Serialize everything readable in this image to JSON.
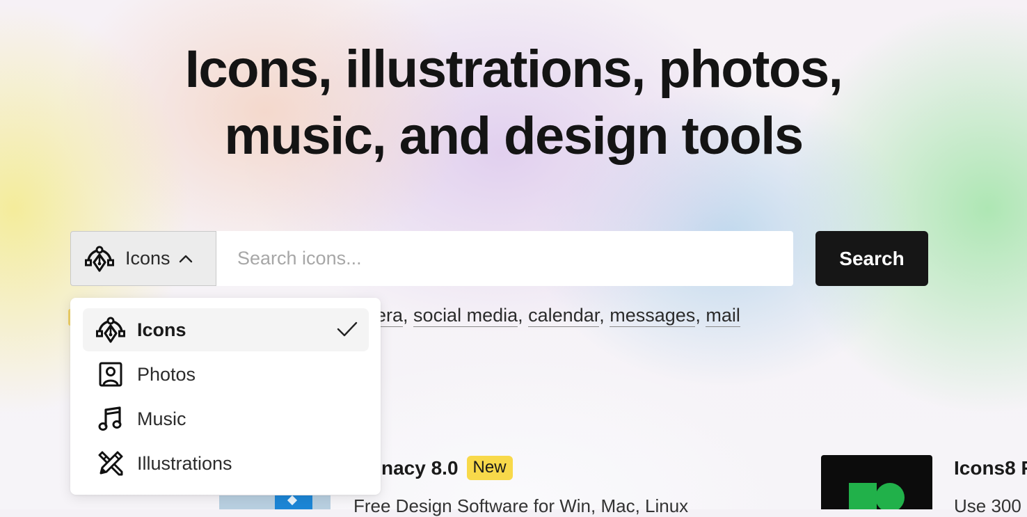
{
  "hero": {
    "title_line1": "Icons, illustrations, photos,",
    "title_line2": "music, and design tools"
  },
  "search": {
    "category_selected": "Icons",
    "category_icon": "pen-tool-icon",
    "chevron_icon": "chevron-up-icon",
    "placeholder": "Search icons...",
    "button_label": "Search"
  },
  "suggestions": {
    "items": [
      "era",
      "social media",
      "calendar",
      "messages",
      "mail"
    ]
  },
  "dropdown": {
    "items": [
      {
        "label": "Icons",
        "icon": "pen-tool-icon",
        "selected": true
      },
      {
        "label": "Photos",
        "icon": "portrait-photo-icon",
        "selected": false
      },
      {
        "label": "Music",
        "icon": "music-note-icon",
        "selected": false
      },
      {
        "label": "Illustrations",
        "icon": "illustration-brush-icon",
        "selected": false
      }
    ],
    "check_icon": "checkmark-icon"
  },
  "cards": {
    "left": {
      "title": "nacy 8.0",
      "badge": "New",
      "description": "Free Design Software for Win, Mac, Linux"
    },
    "right": {
      "title": "Icons8 F",
      "description": "Use 300"
    }
  },
  "colors": {
    "accent_dark": "#161616",
    "badge_yellow": "#f8d94a",
    "thumb_green": "#21b14a"
  }
}
